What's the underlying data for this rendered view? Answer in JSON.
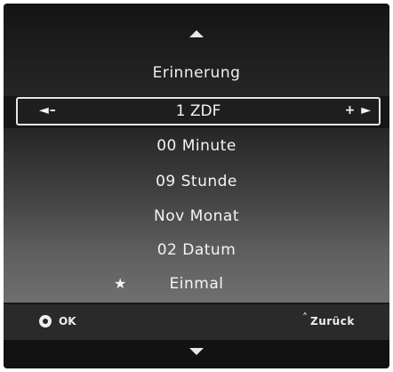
{
  "header": {
    "title": "Erinnerung"
  },
  "channel": {
    "left_control": "◄–",
    "value": "1 ZDF",
    "right_control": "+ ►"
  },
  "items": [
    {
      "label": "00 Minute"
    },
    {
      "label": "09 Stunde"
    },
    {
      "label": "Nov Monat"
    },
    {
      "label": "02 Datum"
    },
    {
      "label": "Einmal",
      "marker": "★"
    }
  ],
  "footer": {
    "ok_label": "OK",
    "back_glyph": "˄",
    "back_label": "Zurück"
  },
  "icons": {
    "up": "triangle-up",
    "down": "triangle-down",
    "ok": "ok-button-circle",
    "star": "star"
  }
}
